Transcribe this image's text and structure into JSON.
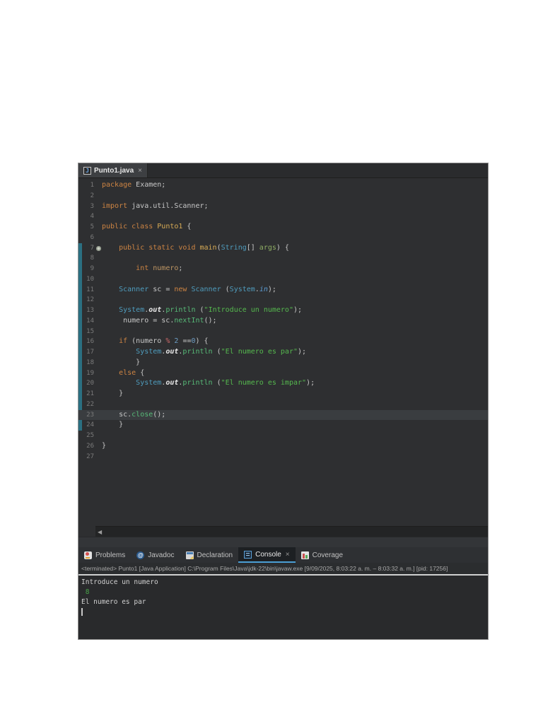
{
  "editor_tab": {
    "label": "Punto1.java",
    "close_glyph": "×",
    "icon": "java-file-icon"
  },
  "editor": {
    "scroll_left_glyph": "◀",
    "current_line": 23,
    "main_marker_line": 7,
    "range_bar": {
      "from_line": 7,
      "to_line": 24,
      "color": "#2b7082"
    },
    "lines": [
      {
        "n": 1,
        "seg": [
          [
            "k",
            "package"
          ],
          [
            "p",
            " Examen;"
          ]
        ]
      },
      {
        "n": 2,
        "seg": []
      },
      {
        "n": 3,
        "seg": [
          [
            "k",
            "import"
          ],
          [
            "p",
            " java.util.Scanner;"
          ]
        ]
      },
      {
        "n": 4,
        "seg": []
      },
      {
        "n": 5,
        "seg": [
          [
            "k",
            "public class "
          ],
          [
            "d",
            "Punto1"
          ],
          [
            "p",
            " {"
          ]
        ]
      },
      {
        "n": 6,
        "seg": []
      },
      {
        "n": 7,
        "seg": [
          [
            "p",
            "    "
          ],
          [
            "k",
            "public static void "
          ],
          [
            "d",
            "main"
          ],
          [
            "p",
            "("
          ],
          [
            "t",
            "String"
          ],
          [
            "p",
            "[] "
          ],
          [
            "a",
            "args"
          ],
          [
            "p",
            ") {"
          ]
        ]
      },
      {
        "n": 8,
        "seg": []
      },
      {
        "n": 9,
        "seg": [
          [
            "p",
            "        "
          ],
          [
            "k",
            "int"
          ],
          [
            "p",
            " "
          ],
          [
            "v",
            "numero"
          ],
          [
            "p",
            ";"
          ]
        ]
      },
      {
        "n": 10,
        "seg": []
      },
      {
        "n": 11,
        "seg": [
          [
            "p",
            "    "
          ],
          [
            "t",
            "Scanner"
          ],
          [
            "p",
            " sc = "
          ],
          [
            "k",
            "new"
          ],
          [
            "p",
            " "
          ],
          [
            "t",
            "Scanner"
          ],
          [
            "p",
            " ("
          ],
          [
            "t",
            "System"
          ],
          [
            "p",
            "."
          ],
          [
            "i",
            "in"
          ],
          [
            "p",
            ");"
          ]
        ]
      },
      {
        "n": 12,
        "seg": []
      },
      {
        "n": 13,
        "seg": [
          [
            "p",
            "    "
          ],
          [
            "t",
            "System"
          ],
          [
            "p",
            "."
          ],
          [
            "o",
            "out"
          ],
          [
            "p",
            "."
          ],
          [
            "m",
            "println"
          ],
          [
            "p",
            " ("
          ],
          [
            "s",
            "\"Introduce un numero\""
          ],
          [
            "p",
            ");"
          ]
        ]
      },
      {
        "n": 14,
        "seg": [
          [
            "p",
            "     numero = sc."
          ],
          [
            "m",
            "nextInt"
          ],
          [
            "p",
            "();"
          ]
        ]
      },
      {
        "n": 15,
        "seg": []
      },
      {
        "n": 16,
        "seg": [
          [
            "p",
            "    "
          ],
          [
            "k",
            "if"
          ],
          [
            "p",
            " (numero "
          ],
          [
            "r",
            "%"
          ],
          [
            "p",
            " "
          ],
          [
            "n",
            "2"
          ],
          [
            "p",
            " =="
          ],
          [
            "n",
            "0"
          ],
          [
            "p",
            ") {"
          ]
        ]
      },
      {
        "n": 17,
        "seg": [
          [
            "p",
            "        "
          ],
          [
            "t",
            "System"
          ],
          [
            "p",
            "."
          ],
          [
            "o",
            "out"
          ],
          [
            "p",
            "."
          ],
          [
            "m",
            "println"
          ],
          [
            "p",
            " ("
          ],
          [
            "s",
            "\"El numero es par\""
          ],
          [
            "p",
            ");"
          ]
        ]
      },
      {
        "n": 18,
        "seg": [
          [
            "p",
            "        }"
          ]
        ]
      },
      {
        "n": 19,
        "seg": [
          [
            "p",
            "    "
          ],
          [
            "k",
            "else"
          ],
          [
            "p",
            " {"
          ]
        ]
      },
      {
        "n": 20,
        "seg": [
          [
            "p",
            "        "
          ],
          [
            "t",
            "System"
          ],
          [
            "p",
            "."
          ],
          [
            "o",
            "out"
          ],
          [
            "p",
            "."
          ],
          [
            "m",
            "println"
          ],
          [
            "p",
            " ("
          ],
          [
            "s",
            "\"El numero es impar\""
          ],
          [
            "p",
            ");"
          ]
        ]
      },
      {
        "n": 21,
        "seg": [
          [
            "p",
            "    }"
          ]
        ]
      },
      {
        "n": 22,
        "seg": []
      },
      {
        "n": 23,
        "seg": [
          [
            "p",
            "    sc."
          ],
          [
            "m",
            "close"
          ],
          [
            "p",
            "();"
          ]
        ]
      },
      {
        "n": 24,
        "seg": [
          [
            "p",
            "    }"
          ]
        ]
      },
      {
        "n": 25,
        "seg": []
      },
      {
        "n": 26,
        "seg": [
          [
            "p",
            "}"
          ]
        ]
      },
      {
        "n": 27,
        "seg": []
      }
    ]
  },
  "bottom_panel": {
    "tabs": [
      {
        "label": "Problems",
        "icon": "problems-icon",
        "selected": false
      },
      {
        "label": "Javadoc",
        "icon": "javadoc-icon",
        "selected": false
      },
      {
        "label": "Declaration",
        "icon": "declaration-icon",
        "selected": false
      },
      {
        "label": "Console",
        "icon": "console-icon",
        "selected": true,
        "close_glyph": "×"
      },
      {
        "label": "Coverage",
        "icon": "coverage-icon",
        "selected": false
      }
    ]
  },
  "console": {
    "status": "<terminated> Punto1 [Java Application] C:\\Program Files\\Java\\jdk-22\\bin\\javaw.exe [9/09/2025, 8:03:22 a. m. – 8:03:32 a. m.] [pid: 17256]",
    "lines": [
      {
        "type": "out",
        "text": "Introduce un numero"
      },
      {
        "type": "in",
        "text": " 8"
      },
      {
        "type": "out",
        "text": "El numero es par"
      }
    ],
    "cursor_visible": true
  },
  "colors": {
    "accent_tab_underline": "#4b9fd5",
    "stdin_green": "#4aa34a",
    "stdout_gray": "#d0d0d0",
    "keyword_orange": "#cd8443",
    "type_blue": "#4f9cbd",
    "string_green": "#55b84e",
    "range_bar_teal": "#2b7082",
    "editor_bg": "#2e2f31",
    "console_bg": "#292a2c"
  }
}
